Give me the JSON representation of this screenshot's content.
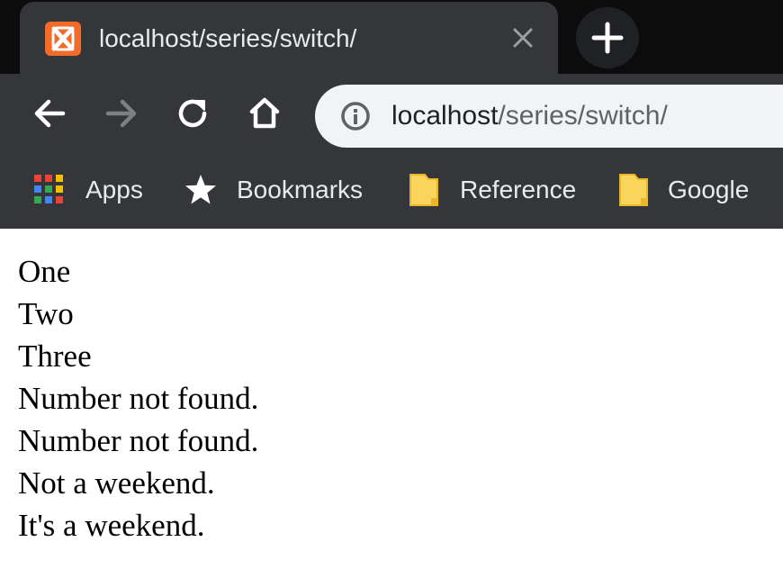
{
  "tab": {
    "title": "localhost/series/switch/",
    "favicon": "xampp-icon",
    "close_icon": "close-icon"
  },
  "new_tab": {
    "icon": "plus-icon"
  },
  "toolbar": {
    "back_icon": "arrow-left-icon",
    "forward_icon": "arrow-right-icon",
    "reload_icon": "reload-icon",
    "home_icon": "home-icon"
  },
  "address_bar": {
    "info_icon": "info-icon",
    "host": "localhost",
    "path": "/series/switch/"
  },
  "bookmarks": [
    {
      "label": "Apps",
      "icon": "apps-grid-icon"
    },
    {
      "label": "Bookmarks",
      "icon": "star-icon"
    },
    {
      "label": "Reference",
      "icon": "folder-icon"
    },
    {
      "label": "Google",
      "icon": "folder-icon"
    }
  ],
  "page": {
    "lines": [
      "One",
      "Two",
      "Three",
      "Number not found.",
      "Number not found.",
      "Not a weekend.",
      "It's a weekend."
    ]
  },
  "colors": {
    "tabstrip": "#0c0c0d",
    "toolbar": "#35363a",
    "omnibox": "#f1f3f4",
    "favicon": "#f26b28",
    "folder": "#fbd45e"
  }
}
